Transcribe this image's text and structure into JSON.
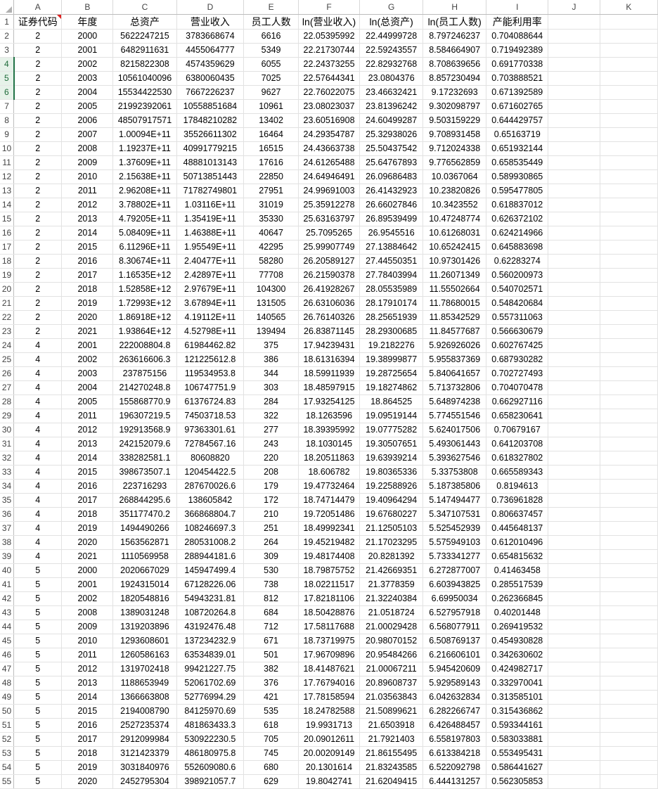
{
  "sheet": {
    "column_letters": [
      "A",
      "B",
      "C",
      "D",
      "E",
      "F",
      "G",
      "H",
      "I",
      "J",
      "K"
    ],
    "selected_rows": [
      4,
      5,
      6
    ],
    "comment_cell": "A1",
    "rows": [
      [
        "证券代码",
        "年度",
        "总资产",
        "营业收入",
        "员工人数",
        "ln(营业收入)",
        "ln(总资产)",
        "ln(员工人数)",
        "产能利用率",
        "",
        ""
      ],
      [
        "2",
        "2000",
        "5622247215",
        "3783668674",
        "6616",
        "22.05395992",
        "22.44999728",
        "8.797246237",
        "0.704088644",
        "",
        ""
      ],
      [
        "2",
        "2001",
        "6482911631",
        "4455064777",
        "5349",
        "22.21730744",
        "22.59243557",
        "8.584664907",
        "0.719492389",
        "",
        ""
      ],
      [
        "2",
        "2002",
        "8215822308",
        "4574359629",
        "6055",
        "22.24373255",
        "22.82932768",
        "8.708639656",
        "0.691770338",
        "",
        ""
      ],
      [
        "2",
        "2003",
        "10561040096",
        "6380060435",
        "7025",
        "22.57644341",
        "23.0804376",
        "8.857230494",
        "0.703888521",
        "",
        ""
      ],
      [
        "2",
        "2004",
        "15534422530",
        "7667226237",
        "9627",
        "22.76022075",
        "23.46632421",
        "9.17232693",
        "0.671392589",
        "",
        ""
      ],
      [
        "2",
        "2005",
        "21992392061",
        "10558851684",
        "10961",
        "23.08023037",
        "23.81396242",
        "9.302098797",
        "0.671602765",
        "",
        ""
      ],
      [
        "2",
        "2006",
        "48507917571",
        "17848210282",
        "13402",
        "23.60516908",
        "24.60499287",
        "9.503159229",
        "0.644429757",
        "",
        ""
      ],
      [
        "2",
        "2007",
        "1.00094E+11",
        "35526611302",
        "16464",
        "24.29354787",
        "25.32938026",
        "9.708931458",
        "0.65163719",
        "",
        ""
      ],
      [
        "2",
        "2008",
        "1.19237E+11",
        "40991779215",
        "16515",
        "24.43663738",
        "25.50437542",
        "9.712024338",
        "0.651932144",
        "",
        ""
      ],
      [
        "2",
        "2009",
        "1.37609E+11",
        "48881013143",
        "17616",
        "24.61265488",
        "25.64767893",
        "9.776562859",
        "0.658535449",
        "",
        ""
      ],
      [
        "2",
        "2010",
        "2.15638E+11",
        "50713851443",
        "22850",
        "24.64946491",
        "26.09686483",
        "10.0367064",
        "0.589930865",
        "",
        ""
      ],
      [
        "2",
        "2011",
        "2.96208E+11",
        "71782749801",
        "27951",
        "24.99691003",
        "26.41432923",
        "10.23820826",
        "0.595477805",
        "",
        ""
      ],
      [
        "2",
        "2012",
        "3.78802E+11",
        "1.03116E+11",
        "31019",
        "25.35912278",
        "26.66027846",
        "10.3423552",
        "0.618837012",
        "",
        ""
      ],
      [
        "2",
        "2013",
        "4.79205E+11",
        "1.35419E+11",
        "35330",
        "25.63163797",
        "26.89539499",
        "10.47248774",
        "0.626372102",
        "",
        ""
      ],
      [
        "2",
        "2014",
        "5.08409E+11",
        "1.46388E+11",
        "40647",
        "25.7095265",
        "26.9545516",
        "10.61268031",
        "0.624214966",
        "",
        ""
      ],
      [
        "2",
        "2015",
        "6.11296E+11",
        "1.95549E+11",
        "42295",
        "25.99907749",
        "27.13884642",
        "10.65242415",
        "0.645883698",
        "",
        ""
      ],
      [
        "2",
        "2016",
        "8.30674E+11",
        "2.40477E+11",
        "58280",
        "26.20589127",
        "27.44550351",
        "10.97301426",
        "0.62283274",
        "",
        ""
      ],
      [
        "2",
        "2017",
        "1.16535E+12",
        "2.42897E+11",
        "77708",
        "26.21590378",
        "27.78403994",
        "11.26071349",
        "0.560200973",
        "",
        ""
      ],
      [
        "2",
        "2018",
        "1.52858E+12",
        "2.97679E+11",
        "104300",
        "26.41928267",
        "28.05535989",
        "11.55502664",
        "0.540702571",
        "",
        ""
      ],
      [
        "2",
        "2019",
        "1.72993E+12",
        "3.67894E+11",
        "131505",
        "26.63106036",
        "28.17910174",
        "11.78680015",
        "0.548420684",
        "",
        ""
      ],
      [
        "2",
        "2020",
        "1.86918E+12",
        "4.19112E+11",
        "140565",
        "26.76140326",
        "28.25651939",
        "11.85342529",
        "0.557311063",
        "",
        ""
      ],
      [
        "2",
        "2021",
        "1.93864E+12",
        "4.52798E+11",
        "139494",
        "26.83871145",
        "28.29300685",
        "11.84577687",
        "0.566630679",
        "",
        ""
      ],
      [
        "4",
        "2001",
        "222008804.8",
        "61984462.82",
        "375",
        "17.94239431",
        "19.2182276",
        "5.926926026",
        "0.602767425",
        "",
        ""
      ],
      [
        "4",
        "2002",
        "263616606.3",
        "121225612.8",
        "386",
        "18.61316394",
        "19.38999877",
        "5.955837369",
        "0.687930282",
        "",
        ""
      ],
      [
        "4",
        "2003",
        "237875156",
        "119534953.8",
        "344",
        "18.59911939",
        "19.28725654",
        "5.840641657",
        "0.702727493",
        "",
        ""
      ],
      [
        "4",
        "2004",
        "214270248.8",
        "106747751.9",
        "303",
        "18.48597915",
        "19.18274862",
        "5.713732806",
        "0.704070478",
        "",
        ""
      ],
      [
        "4",
        "2005",
        "155868770.9",
        "61376724.83",
        "284",
        "17.93254125",
        "18.864525",
        "5.648974238",
        "0.662927116",
        "",
        ""
      ],
      [
        "4",
        "2011",
        "196307219.5",
        "74503718.53",
        "322",
        "18.1263596",
        "19.09519144",
        "5.774551546",
        "0.658230641",
        "",
        ""
      ],
      [
        "4",
        "2012",
        "192913568.9",
        "97363301.61",
        "277",
        "18.39395992",
        "19.07775282",
        "5.624017506",
        "0.70679167",
        "",
        ""
      ],
      [
        "4",
        "2013",
        "242152079.6",
        "72784567.16",
        "243",
        "18.1030145",
        "19.30507651",
        "5.493061443",
        "0.641203708",
        "",
        ""
      ],
      [
        "4",
        "2014",
        "338282581.1",
        "80608820",
        "220",
        "18.20511863",
        "19.63939214",
        "5.393627546",
        "0.618327802",
        "",
        ""
      ],
      [
        "4",
        "2015",
        "398673507.1",
        "120454422.5",
        "208",
        "18.606782",
        "19.80365336",
        "5.33753808",
        "0.665589343",
        "",
        ""
      ],
      [
        "4",
        "2016",
        "223716293",
        "287670026.6",
        "179",
        "19.47732464",
        "19.22588926",
        "5.187385806",
        "0.8194613",
        "",
        ""
      ],
      [
        "4",
        "2017",
        "268844295.6",
        "138605842",
        "172",
        "18.74714479",
        "19.40964294",
        "5.147494477",
        "0.736961828",
        "",
        ""
      ],
      [
        "4",
        "2018",
        "351177470.2",
        "366868804.7",
        "210",
        "19.72051486",
        "19.67680227",
        "5.347107531",
        "0.806637457",
        "",
        ""
      ],
      [
        "4",
        "2019",
        "1494490266",
        "108246697.3",
        "251",
        "18.49992341",
        "21.12505103",
        "5.525452939",
        "0.445648137",
        "",
        ""
      ],
      [
        "4",
        "2020",
        "1563562871",
        "280531008.2",
        "264",
        "19.45219482",
        "21.17023295",
        "5.575949103",
        "0.612010496",
        "",
        ""
      ],
      [
        "4",
        "2021",
        "1110569958",
        "288944181.6",
        "309",
        "19.48174408",
        "20.8281392",
        "5.733341277",
        "0.654815632",
        "",
        ""
      ],
      [
        "5",
        "2000",
        "2020667029",
        "145947499.4",
        "530",
        "18.79875752",
        "21.42669351",
        "6.272877007",
        "0.41463458",
        "",
        ""
      ],
      [
        "5",
        "2001",
        "1924315014",
        "67128226.06",
        "738",
        "18.02211517",
        "21.3778359",
        "6.603943825",
        "0.285517539",
        "",
        ""
      ],
      [
        "5",
        "2002",
        "1820548816",
        "54943231.81",
        "812",
        "17.82181106",
        "21.32240384",
        "6.69950034",
        "0.262366845",
        "",
        ""
      ],
      [
        "5",
        "2008",
        "1389031248",
        "108720264.8",
        "684",
        "18.50428876",
        "21.0518724",
        "6.527957918",
        "0.40201448",
        "",
        ""
      ],
      [
        "5",
        "2009",
        "1319203896",
        "43192476.48",
        "712",
        "17.58117688",
        "21.00029428",
        "6.568077911",
        "0.269419532",
        "",
        ""
      ],
      [
        "5",
        "2010",
        "1293608601",
        "137234232.9",
        "671",
        "18.73719975",
        "20.98070152",
        "6.508769137",
        "0.454930828",
        "",
        ""
      ],
      [
        "5",
        "2011",
        "1260586163",
        "63534839.01",
        "501",
        "17.96709896",
        "20.95484266",
        "6.216606101",
        "0.342630602",
        "",
        ""
      ],
      [
        "5",
        "2012",
        "1319702418",
        "99421227.75",
        "382",
        "18.41487621",
        "21.00067211",
        "5.945420609",
        "0.424982717",
        "",
        ""
      ],
      [
        "5",
        "2013",
        "1188653949",
        "52061702.69",
        "376",
        "17.76794016",
        "20.89608737",
        "5.929589143",
        "0.332970041",
        "",
        ""
      ],
      [
        "5",
        "2014",
        "1366663808",
        "52776994.29",
        "421",
        "17.78158594",
        "21.03563843",
        "6.042632834",
        "0.313585101",
        "",
        ""
      ],
      [
        "5",
        "2015",
        "2194008790",
        "84125970.69",
        "535",
        "18.24782588",
        "21.50899621",
        "6.282266747",
        "0.315436862",
        "",
        ""
      ],
      [
        "5",
        "2016",
        "2527235374",
        "481863433.3",
        "618",
        "19.9931713",
        "21.6503918",
        "6.426488457",
        "0.593344161",
        "",
        ""
      ],
      [
        "5",
        "2017",
        "2912099984",
        "530922230.5",
        "705",
        "20.09012611",
        "21.7921403",
        "6.558197803",
        "0.583033881",
        "",
        ""
      ],
      [
        "5",
        "2018",
        "3121423379",
        "486180975.8",
        "745",
        "20.00209149",
        "21.86155495",
        "6.613384218",
        "0.553495431",
        "",
        ""
      ],
      [
        "5",
        "2019",
        "3031840976",
        "552609080.6",
        "680",
        "20.1301614",
        "21.83243585",
        "6.522092798",
        "0.586441627",
        "",
        ""
      ],
      [
        "5",
        "2020",
        "2452795304",
        "398921057.7",
        "629",
        "19.8042741",
        "21.62049415",
        "6.444131257",
        "0.562305853",
        "",
        ""
      ]
    ]
  }
}
